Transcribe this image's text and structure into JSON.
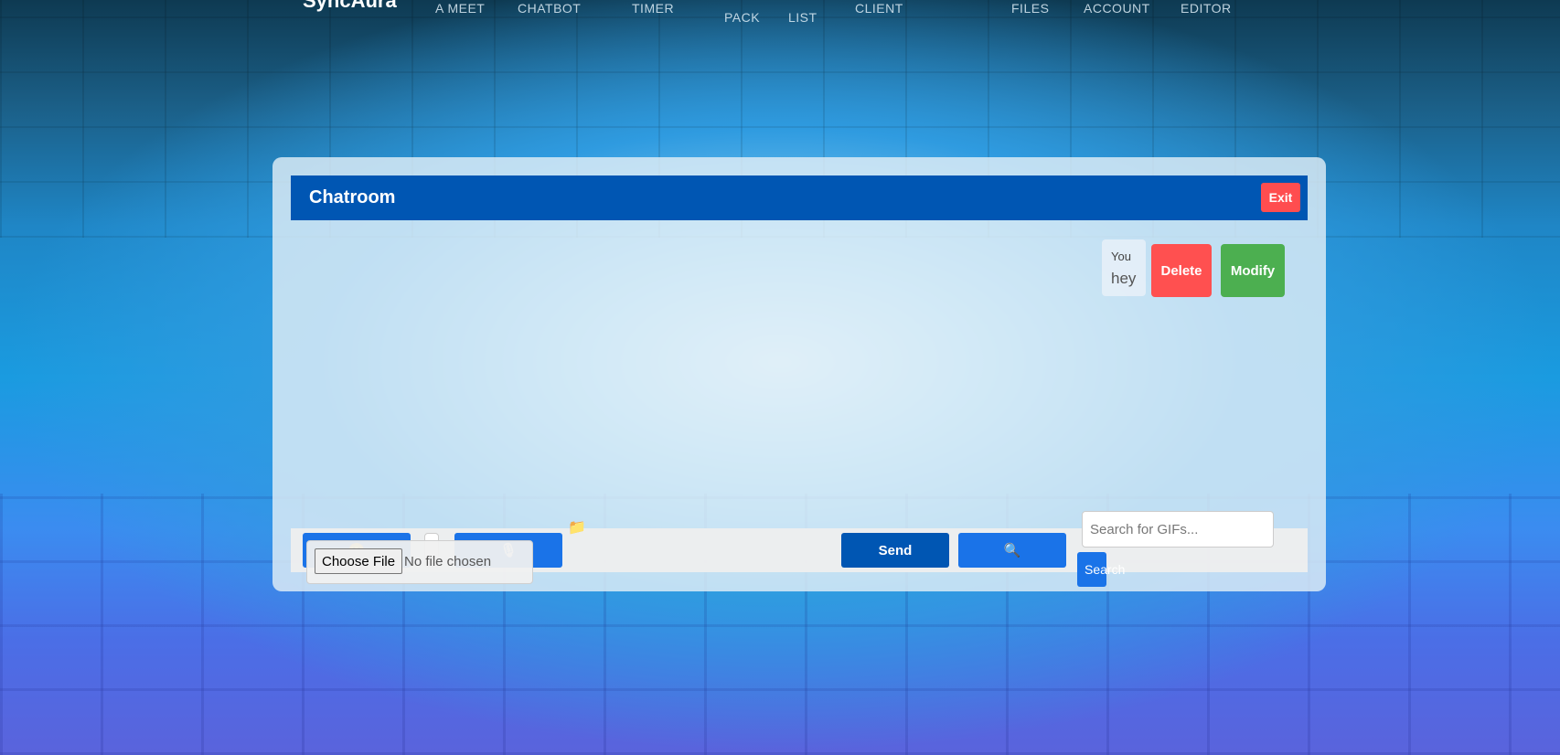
{
  "brand": "SyncAura",
  "nav": [
    {
      "label": "A MEET"
    },
    {
      "label": "CHATBOT"
    },
    {
      "label": "TIMER"
    },
    {
      "label": "PACK"
    },
    {
      "label": "LIST"
    },
    {
      "label": "CLIENT"
    },
    {
      "label": "FILES"
    },
    {
      "label": "ACCOUNT"
    },
    {
      "label": "EDITOR"
    }
  ],
  "chat": {
    "title": "Chatroom",
    "exit_label": "Exit",
    "messages": [
      {
        "sender": "You",
        "text": "hey",
        "delete_label": "Delete",
        "modify_label": "Modify"
      }
    ]
  },
  "inputbar": {
    "emoji_icon": "😊",
    "mic_icon": "🎙",
    "folder_icon": "📁",
    "choose_file_label": "Choose File",
    "file_status": "No file chosen",
    "send_label": "Send",
    "search_icon": "🔍",
    "gif_placeholder": "Search for GIFs...",
    "gif_search_label": "Search"
  },
  "colors": {
    "header": "#0056b3",
    "primary_button": "#1a73e8",
    "send_button": "#0056b3",
    "delete_button": "#ff5050",
    "modify_button": "#4caf50",
    "exit_button": "#ff4d4f"
  }
}
